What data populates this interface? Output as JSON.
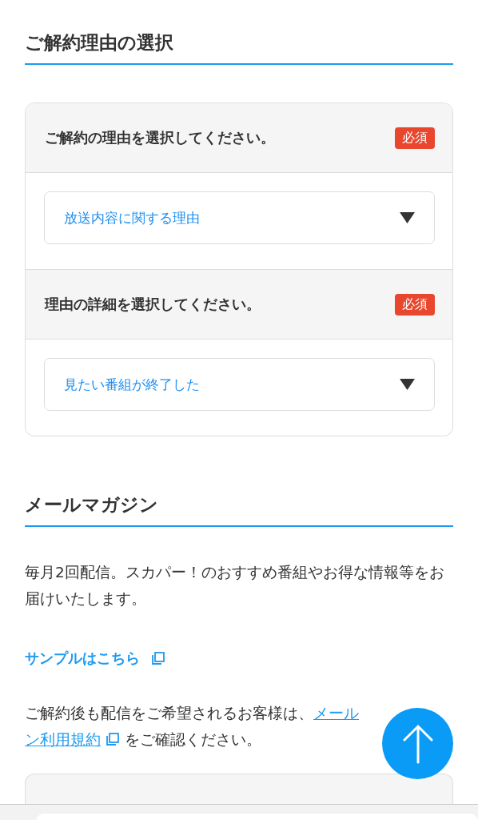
{
  "sections": [
    {
      "title": "ご解約理由の選択"
    },
    {
      "title": "メールマガジン"
    }
  ],
  "reason_card": {
    "questions": [
      {
        "label": "ご解約の理由を選択してください。",
        "badge": "必須",
        "value": "放送内容に関する理由"
      },
      {
        "label": "理由の詳細を選択してください。",
        "badge": "必須",
        "value": "見たい番組が終了した"
      }
    ]
  },
  "newsletter": {
    "description": "毎月2回配信。スカパー！のおすすめ番組やお得な情報等をお届けいたします。",
    "sample_link": "サンプルはこちら",
    "note_before": "ご解約後も配信をご希望されるお客様は、",
    "terms_link_parts": [
      "メール",
      "ン利用規約"
    ],
    "note_after": "をご確認ください。"
  }
}
